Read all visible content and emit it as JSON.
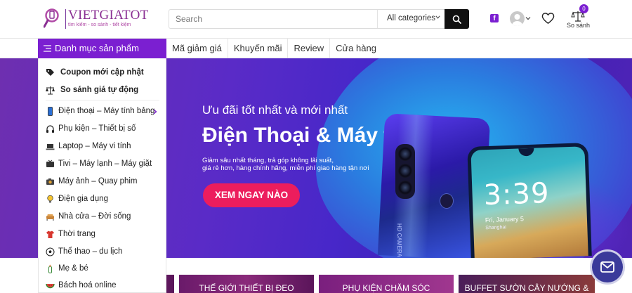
{
  "brand": {
    "name": "VIETGIATOT",
    "tagline": "tìm kiếm - so sánh - tiết kiệm",
    "primary_color": "#7b1fd1",
    "accent_color": "#ec1d5d"
  },
  "search": {
    "placeholder": "Search",
    "category_selected": "All categories",
    "submit_icon": "search-icon"
  },
  "header_actions": {
    "facebook_icon": "facebook-icon",
    "account_icon": "user-avatar-icon",
    "wishlist_icon": "heart-icon",
    "compare_badge": "0",
    "compare_label": "So sánh"
  },
  "nav": {
    "categories_toggle": "Danh mục sản phẩm",
    "links": [
      "Mã giảm giá",
      "Khuyến mãi",
      "Review",
      "Cửa hàng"
    ]
  },
  "side_menu": {
    "featured": [
      {
        "label": "Coupon mới cập nhật",
        "icon": "tag-icon"
      },
      {
        "label": "So sánh giá tự động",
        "icon": "scale-icon"
      }
    ],
    "categories": [
      {
        "label": "Điện thoại – Máy tính bảng",
        "icon": "phone-icon",
        "has_submenu": true
      },
      {
        "label": "Phụ kiện – Thiết bị số",
        "icon": "headphones-icon"
      },
      {
        "label": "Laptop – Máy vi tính",
        "icon": "laptop-icon"
      },
      {
        "label": "Tivi – Máy lạnh – Máy giặt",
        "icon": "tv-icon"
      },
      {
        "label": "Máy ảnh – Quay phim",
        "icon": "camera-icon"
      },
      {
        "label": "Điện gia dụng",
        "icon": "lightbulb-icon"
      },
      {
        "label": "Nhà cửa – Đời sống",
        "icon": "sofa-icon"
      },
      {
        "label": "Thời trang",
        "icon": "shirt-icon"
      },
      {
        "label": "Thể thao – du lịch",
        "icon": "soccer-ball-icon"
      },
      {
        "label": "Mẹ & bé",
        "icon": "baby-bottle-icon"
      },
      {
        "label": "Bách hoá online",
        "icon": "watermelon-icon"
      }
    ]
  },
  "hero": {
    "kicker": "Ưu đãi tốt nhất và mới nhất",
    "title": "Điện Thoại & Máy tính Bảng",
    "description_line1": "Giảm sâu nhất tháng, trả góp không lãi suất,",
    "description_line2": "giá rẻ hơn, hàng chính hãng, miễn phí giao hàng tận nơi",
    "cta": "XEM NGAY NÀO",
    "phone_brand": "HD CAMERA",
    "phone_clock": "3:39",
    "phone_date": "Fri, January 5",
    "phone_location": "Shanghai"
  },
  "promo_tiles": [
    "",
    "THẾ GIỚI THIẾT BỊ ĐEO",
    "PHỤ KIỆN CHĂM SÓC",
    "BUFFET SƯỜN CÂY NƯỚNG &"
  ],
  "chat": {
    "icon": "mail-chat-icon"
  }
}
